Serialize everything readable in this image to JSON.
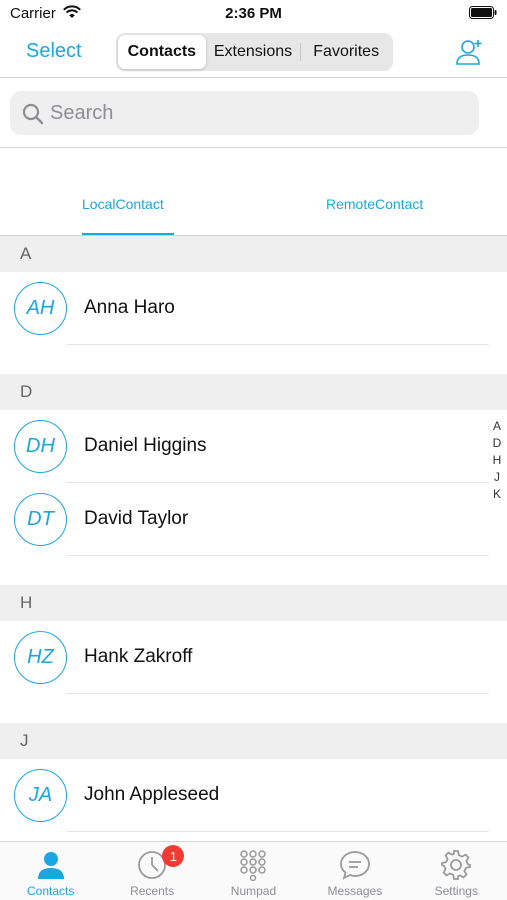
{
  "status_bar": {
    "carrier": "Carrier",
    "time": "2:36 PM"
  },
  "nav": {
    "select_label": "Select",
    "segments": [
      "Contacts",
      "Extensions",
      "Favorites"
    ],
    "selected_segment": "Contacts"
  },
  "search": {
    "placeholder": "Search",
    "value": ""
  },
  "source_tabs": {
    "local": "LocalContact",
    "remote": "RemoteContact",
    "selected": "LocalContact"
  },
  "sections": [
    {
      "letter": "A",
      "contacts": [
        {
          "initials": "AH",
          "name": "Anna Haro"
        }
      ]
    },
    {
      "letter": "D",
      "contacts": [
        {
          "initials": "DH",
          "name": "Daniel Higgins"
        },
        {
          "initials": "DT",
          "name": "David Taylor"
        }
      ]
    },
    {
      "letter": "H",
      "contacts": [
        {
          "initials": "HZ",
          "name": "Hank Zakroff"
        }
      ]
    },
    {
      "letter": "J",
      "contacts": [
        {
          "initials": "JA",
          "name": "John Appleseed"
        }
      ]
    }
  ],
  "index_letters": [
    "A",
    "D",
    "H",
    "J",
    "K"
  ],
  "tab_bar": {
    "items": [
      {
        "label": "Contacts",
        "icon": "person-icon"
      },
      {
        "label": "Recents",
        "icon": "clock-icon",
        "badge": "1"
      },
      {
        "label": "Numpad",
        "icon": "keypad-icon"
      },
      {
        "label": "Messages",
        "icon": "message-bubble-icon"
      },
      {
        "label": "Settings",
        "icon": "gear-icon"
      }
    ],
    "active": "Contacts"
  },
  "colors": {
    "accent": "#1aa6df",
    "badge": "#f23b32",
    "section_bg": "#efefef"
  }
}
